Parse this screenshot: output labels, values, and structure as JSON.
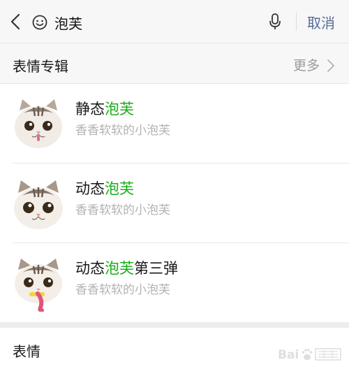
{
  "search": {
    "query": "泡芙",
    "cancel_label": "取消"
  },
  "albums": {
    "title": "表情专辑",
    "more_label": "更多",
    "items": [
      {
        "title_prefix": "静态",
        "title_highlight": "泡芙",
        "title_suffix": "",
        "subtitle": "香香软软的小泡芙"
      },
      {
        "title_prefix": "动态",
        "title_highlight": "泡芙",
        "title_suffix": "",
        "subtitle": "香香软软的小泡芙"
      },
      {
        "title_prefix": "动态",
        "title_highlight": "泡芙",
        "title_suffix": "第三弹",
        "subtitle": "香香软软的小泡芙"
      }
    ]
  },
  "stickers": {
    "title": "表情"
  },
  "colors": {
    "highlight": "#1aad19",
    "link": "#576b95",
    "subtitle": "#b2b2b2"
  }
}
